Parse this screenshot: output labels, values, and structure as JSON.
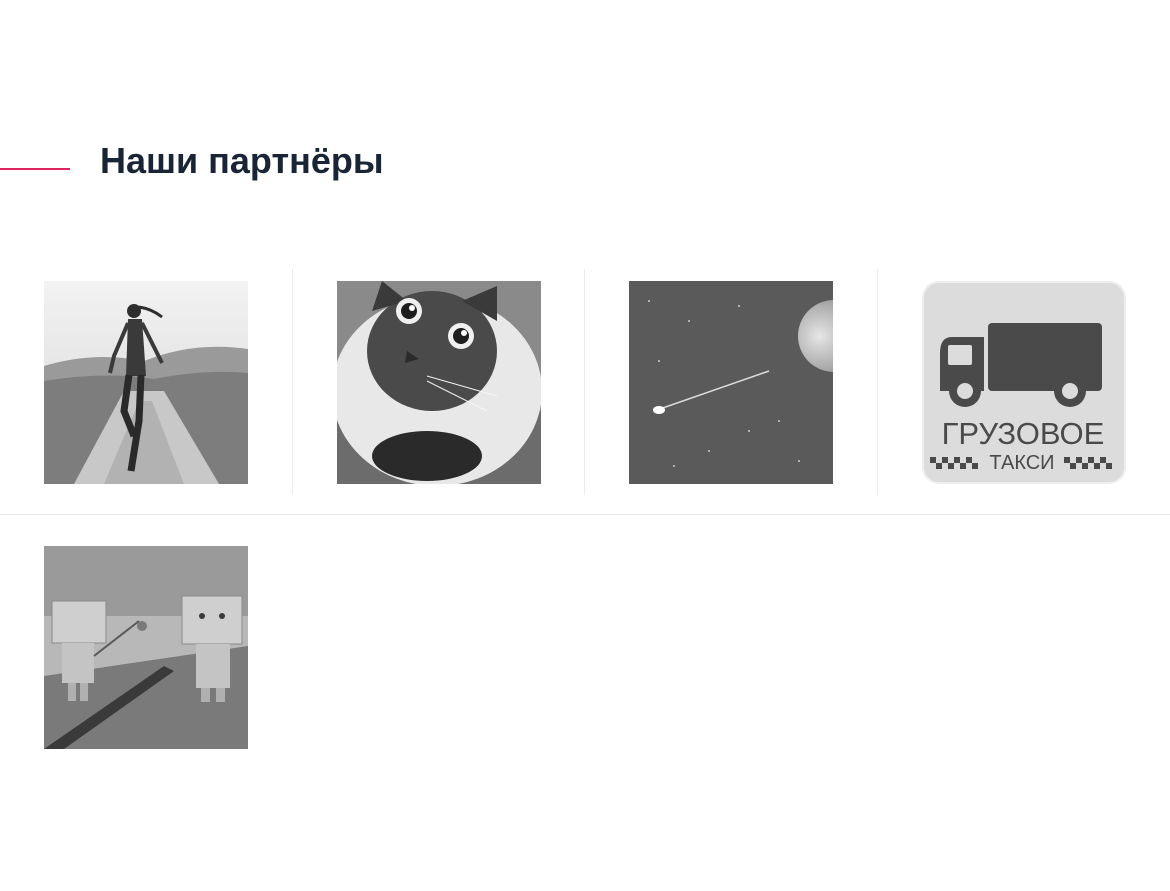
{
  "section": {
    "title": "Наши партнёры"
  },
  "partners": [
    {
      "icon": "runner-photo-icon"
    },
    {
      "icon": "cat-photo-icon"
    },
    {
      "icon": "space-comet-photo-icon"
    },
    {
      "icon": "cargo-taxi-logo-icon",
      "logo_line1": "ГРУЗОВОЕ",
      "logo_line2": "ТАКСИ"
    },
    {
      "icon": "cardboard-robots-photo-icon"
    }
  ],
  "colors": {
    "accent": "#e0245e",
    "heading": "#1a2437"
  }
}
